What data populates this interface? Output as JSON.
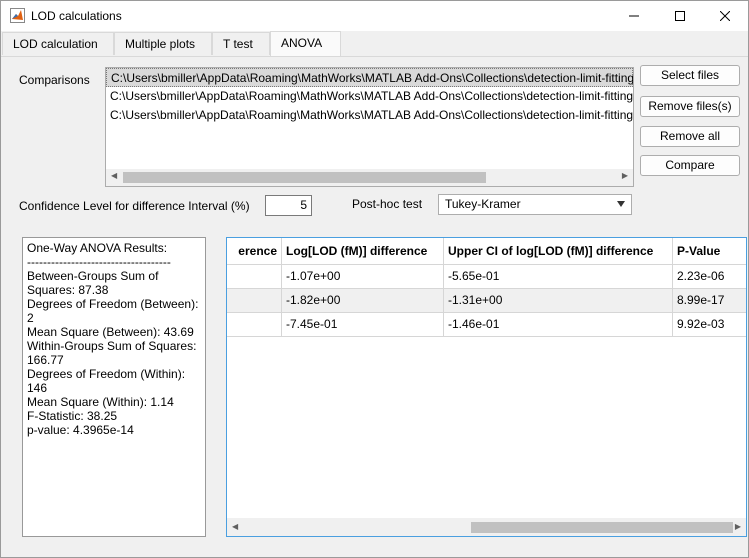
{
  "window": {
    "title": "LOD calculations"
  },
  "tabs": [
    "LOD calculation",
    "Multiple plots",
    "T test",
    "ANOVA"
  ],
  "comparisons": {
    "label": "Comparisons",
    "files": [
      "C:\\Users\\bmiller\\AppData\\Roaming\\MathWorks\\MATLAB Add-Ons\\Collections\\detection-limit-fitting",
      "C:\\Users\\bmiller\\AppData\\Roaming\\MathWorks\\MATLAB Add-Ons\\Collections\\detection-limit-fitting",
      "C:\\Users\\bmiller\\AppData\\Roaming\\MathWorks\\MATLAB Add-Ons\\Collections\\detection-limit-fitting"
    ]
  },
  "buttons": {
    "select_files": "Select files",
    "remove_files": "Remove files(s)",
    "remove_all": "Remove all",
    "compare": "Compare"
  },
  "confidence": {
    "label": "Confidence Level for difference Interval (%)",
    "value": "5"
  },
  "posthoc": {
    "label": "Post-hoc test",
    "selected": "Tukey-Kramer"
  },
  "results": {
    "lines": [
      "One-Way ANOVA Results:",
      "------------------------------------",
      "Between-Groups Sum of Squares: 87.38",
      "Degrees of Freedom (Between): 2",
      "Mean Square (Between): 43.69",
      "Within-Groups Sum of Squares: 166.77",
      "Degrees of Freedom (Within): 146",
      "Mean Square (Within): 1.14",
      "F-Statistic: 38.25",
      "p-value: 4.3965e-14"
    ]
  },
  "table": {
    "headers": [
      "erence",
      "Log[LOD (fM)] difference",
      "Upper CI of log[LOD (fM)] difference",
      "P-Value"
    ],
    "rows": [
      [
        "",
        "-1.07e+00",
        "-5.65e-01",
        "2.23e-06"
      ],
      [
        "",
        "-1.82e+00",
        "-1.31e+00",
        "8.99e-17"
      ],
      [
        "",
        "-7.45e-01",
        "-1.46e-01",
        "9.92e-03"
      ]
    ]
  }
}
